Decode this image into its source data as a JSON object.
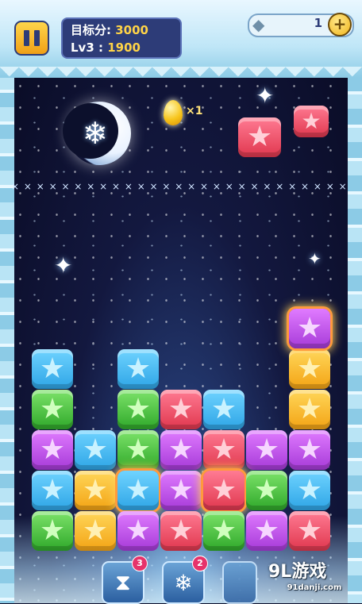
{
  "hud": {
    "pause_icon": "pause-icon",
    "target_label": "目标分:",
    "target_value": "3000",
    "level_label": "Lv3 :",
    "level_score": "1900",
    "gems": "1",
    "gem_icon": "diamond-icon",
    "add_label": "+"
  },
  "bonus": {
    "egg_icon": "golden-egg-icon",
    "egg_multiplier": "×1"
  },
  "limit_line": "× × × × × × × × × × × × × × × × × × × × × × × × × × × × × × × × × × × × × ×",
  "board": {
    "columns": 7,
    "rows": [
      [
        "blue",
        "",
        "blue",
        "",
        "",
        "",
        "yellow"
      ],
      [
        "green",
        "",
        "green",
        "red",
        "blue",
        "",
        "yellow"
      ],
      [
        "purple",
        "blue",
        "green",
        "purple",
        "red",
        "purple",
        "purple"
      ],
      [
        "blue",
        "yellow",
        "blue*",
        "purple",
        "red*",
        "green",
        "blue"
      ],
      [
        "green",
        "yellow",
        "purple",
        "red",
        "green",
        "purple",
        "red"
      ]
    ],
    "top_extra": [
      "purple*"
    ],
    "falling": [
      "red",
      "red"
    ]
  },
  "tools": [
    {
      "icon": "hourglass-icon",
      "glyph": "⧗",
      "count": "3"
    },
    {
      "icon": "snowflake-icon",
      "glyph": "❄",
      "count": "2"
    }
  ],
  "watermark": {
    "logo": "9L游戏",
    "site": "91danji.com"
  },
  "colors": {
    "blue": "#2ea5e6",
    "green": "#2fa82a",
    "red": "#e0374e",
    "yellow": "#f3a314",
    "purple": "#a63ad8"
  }
}
